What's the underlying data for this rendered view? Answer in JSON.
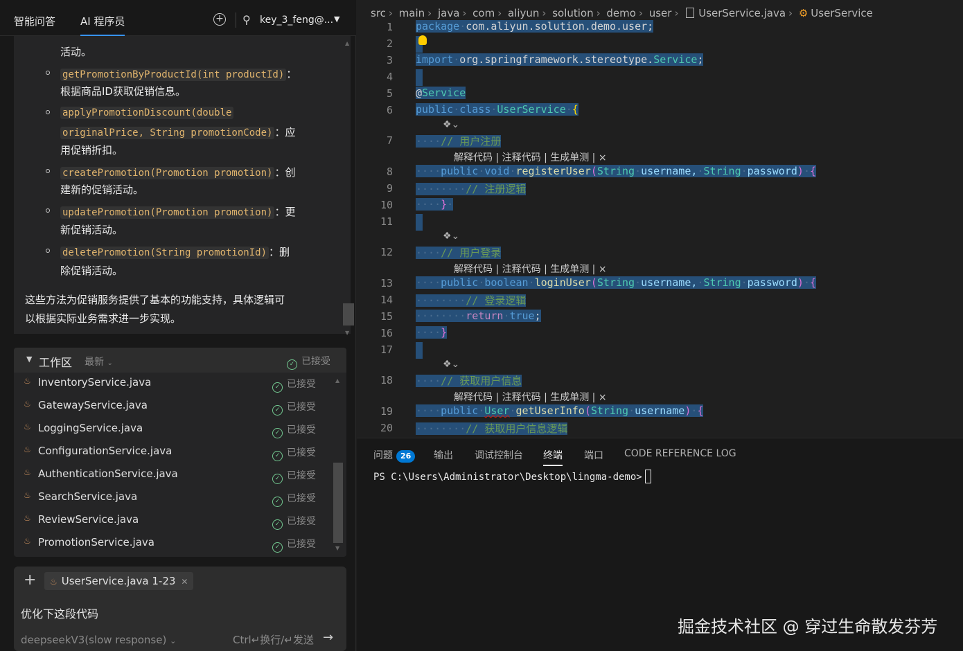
{
  "top_tabs": {
    "qa": "智能问答",
    "ai_coder": "AI 程序员"
  },
  "account": {
    "name": "key_3_feng@..."
  },
  "chat": {
    "cut_line": "活动。",
    "methods": [
      {
        "code": "getPromotionByProductId(int productId)",
        "rest": "：",
        "line2": "根据商品ID获取促销信息。"
      },
      {
        "code": "applyPromotionDiscount(double",
        "rest": "",
        "code2": "originalPrice, String promotionCode)",
        "rest2": "：应",
        "line2": "用促销折扣。"
      },
      {
        "code": "createPromotion(Promotion promotion)",
        "rest": "：创",
        "line2": "建新的促销活动。"
      },
      {
        "code": "updatePromotion(Promotion promotion)",
        "rest": "：更",
        "line2": "新促销活动。"
      },
      {
        "code": "deletePromotion(String promotionId)",
        "rest": "：删",
        "line2": "除促销活动。"
      }
    ],
    "summary_line1": "这些方法为促销服务提供了基本的功能支持，具体逻辑可",
    "summary_line2": "以根据实际业务需求进一步实现。"
  },
  "workspace": {
    "title": "工作区",
    "sort": "最新",
    "status": "已接受",
    "files": [
      {
        "name": "InventoryService.java",
        "status": "已接受"
      },
      {
        "name": "GatewayService.java",
        "status": "已接受"
      },
      {
        "name": "LoggingService.java",
        "status": "已接受"
      },
      {
        "name": "ConfigurationService.java",
        "status": "已接受"
      },
      {
        "name": "AuthenticationService.java",
        "status": "已接受"
      },
      {
        "name": "SearchService.java",
        "status": "已接受"
      },
      {
        "name": "ReviewService.java",
        "status": "已接受"
      },
      {
        "name": "PromotionService.java",
        "status": "已接受"
      }
    ]
  },
  "composer": {
    "context_file": "UserService.java 1-23",
    "prompt": "优化下这段代码",
    "model": "deepseekV3(slow response)",
    "hint": "Ctrl↵换行/↵发送"
  },
  "breadcrumb": [
    "src",
    "main",
    "java",
    "com",
    "aliyun",
    "solution",
    "demo",
    "user",
    "UserService.java",
    "UserService"
  ],
  "code": {
    "line_numbers": [
      "1",
      "2",
      "3",
      "4",
      "5",
      "6",
      "7",
      "8",
      "9",
      "10",
      "11",
      "12",
      "13",
      "14",
      "15",
      "16",
      "17",
      "18",
      "19",
      "20"
    ],
    "l1_kw": "package",
    "l1_rest": "com.aliyun.solution.demo.user;",
    "l3_kw": "import",
    "l3_pkg": "org.springframework.stereotype.",
    "l3_cls": "Service",
    "l3_end": ";",
    "l5_at": "@",
    "l5_ann": "Service",
    "l6_public": "public",
    "l6_class": "class",
    "l6_name": "UserService",
    "l6_brace": "{",
    "l7_comment": "// 用户注册",
    "l8_public": "public",
    "l8_void": "void",
    "l8_fn": "registerUser",
    "l8_open": "(",
    "l8_t1": "String",
    "l8_p1": "username,",
    "l8_t2": "String",
    "l8_p2": "password",
    "l8_close": ")",
    "l8_brace": "{",
    "l9_comment": "// 注册逻辑",
    "l10_brace": "}",
    "l12_comment": "// 用户登录",
    "l13_public": "public",
    "l13_bool": "boolean",
    "l13_fn": "loginUser",
    "l13_open": "(",
    "l13_t1": "String",
    "l13_p1": "username,",
    "l13_t2": "String",
    "l13_p2": "password",
    "l13_close": ")",
    "l13_brace": "{",
    "l14_comment": "// 登录逻辑",
    "l15_return": "return",
    "l15_true": "true",
    "l15_end": ";",
    "l16_brace": "}",
    "l18_comment": "// 获取用户信息",
    "l19_public": "public",
    "l19_type": "User",
    "l19_fn": "getUserInfo",
    "l19_open": "(",
    "l19_t1": "String",
    "l19_p1": "username",
    "l19_close": ")",
    "l19_brace": "{",
    "l20_comment": "// 获取用户信息逻辑"
  },
  "codelens": "解释代码 | 注释代码 | 生成单测 | ×",
  "panel": {
    "tabs": {
      "problems": "问题",
      "output": "输出",
      "debug": "调试控制台",
      "terminal": "终端",
      "ports": "端口",
      "code_ref": "CODE REFERENCE LOG"
    },
    "problems_count": "26",
    "terminal_line": "PS C:\\Users\\Administrator\\Desktop\\lingma-demo>"
  },
  "watermark": "掘金技术社区 @ 穿过生命散发芬芳",
  "colors": {
    "accent": "#3794ff",
    "selection": "#264f78",
    "badge": "#0078d4",
    "accepted": "#73c991"
  }
}
